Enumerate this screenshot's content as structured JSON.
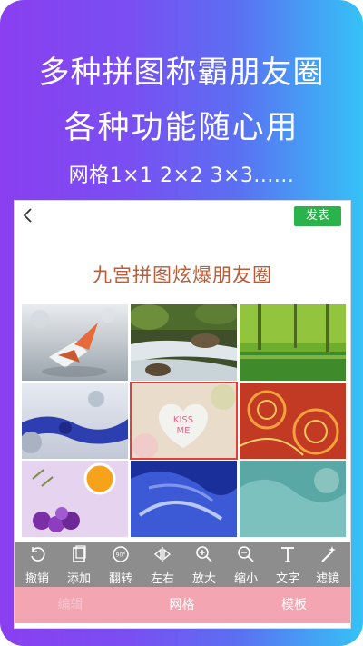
{
  "promo": {
    "line1": "多种拼图称霸朋友圈",
    "line2": "各种功能随心用",
    "line3": "网格1×1  2×2  3×3......"
  },
  "topbar": {
    "back_icon": "chevron-left-icon",
    "publish_label": "发表",
    "publish_color": "#2ab34a"
  },
  "page_title": "九宫拼图炫爆朋友圈",
  "grid": {
    "cells": [
      {
        "name": "paper-crane"
      },
      {
        "name": "waterfall"
      },
      {
        "name": "forest-lake"
      },
      {
        "name": "blue-spheres"
      },
      {
        "name": "candy-heart",
        "text": "KISS ME",
        "selected": true
      },
      {
        "name": "red-swirls"
      },
      {
        "name": "violet-flowers-sun"
      },
      {
        "name": "blue-glass"
      },
      {
        "name": "teal-water"
      }
    ]
  },
  "toolbar": {
    "items": [
      {
        "label": "撤销",
        "icon": "undo-icon"
      },
      {
        "label": "添加",
        "icon": "add-photo-icon"
      },
      {
        "label": "翻转",
        "icon": "rotate-90-icon",
        "badge": "90°"
      },
      {
        "label": "左右",
        "icon": "flip-horizontal-icon"
      },
      {
        "label": "放大",
        "icon": "zoom-in-icon"
      },
      {
        "label": "缩小",
        "icon": "zoom-out-icon"
      },
      {
        "label": "文字",
        "icon": "text-icon"
      },
      {
        "label": "滤镜",
        "icon": "magic-wand-icon"
      }
    ]
  },
  "tabs": [
    {
      "label": "编辑",
      "active": false
    },
    {
      "label": "网格",
      "active": true
    },
    {
      "label": "模板",
      "active": true
    }
  ],
  "colors": {
    "gradient_start": "#8a3ff0",
    "gradient_end": "#35c2f6",
    "title_color": "#b85c3a",
    "toolbar_bg": "#8d8d8d",
    "tabs_bg": "#f3a5b2"
  }
}
